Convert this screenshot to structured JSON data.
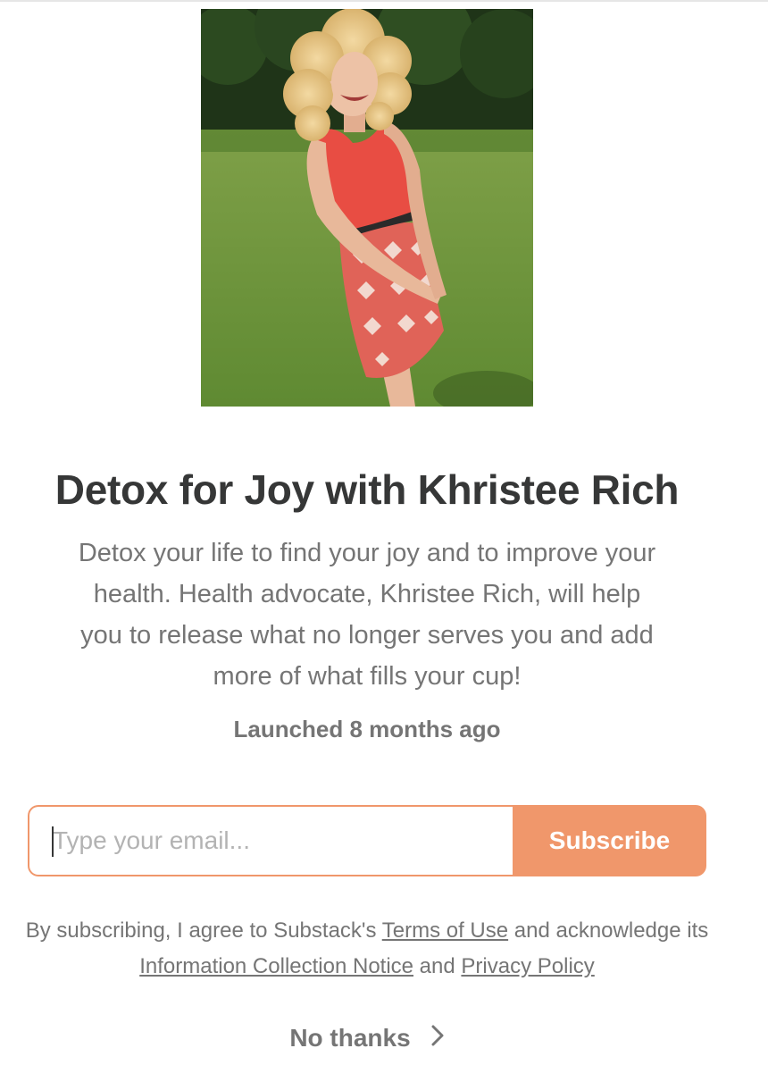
{
  "hero": {
    "image_alt": "Photo of Khristee Rich"
  },
  "publication": {
    "title": "Detox for Joy with Khristee Rich",
    "description": "Detox your life to find your joy and to improve your health. Health advocate, Khristee Rich, will help you to release what no longer serves you and add more of what fills your cup!",
    "launched": "Launched 8 months ago"
  },
  "subscribe_form": {
    "email_placeholder": "Type your email...",
    "email_value": "",
    "button_label": "Subscribe"
  },
  "legal": {
    "prefix": "By subscribing, I agree to Substack's ",
    "terms_link": "Terms of Use",
    "middle": " and acknowledge its ",
    "info_link": "Information Collection Notice",
    "and": " and ",
    "privacy_link": "Privacy Policy"
  },
  "no_thanks": {
    "label": "No thanks",
    "icon": "chevron-right-icon"
  },
  "colors": {
    "accent": "#f0976b",
    "text": "#363737",
    "muted": "#757575"
  }
}
